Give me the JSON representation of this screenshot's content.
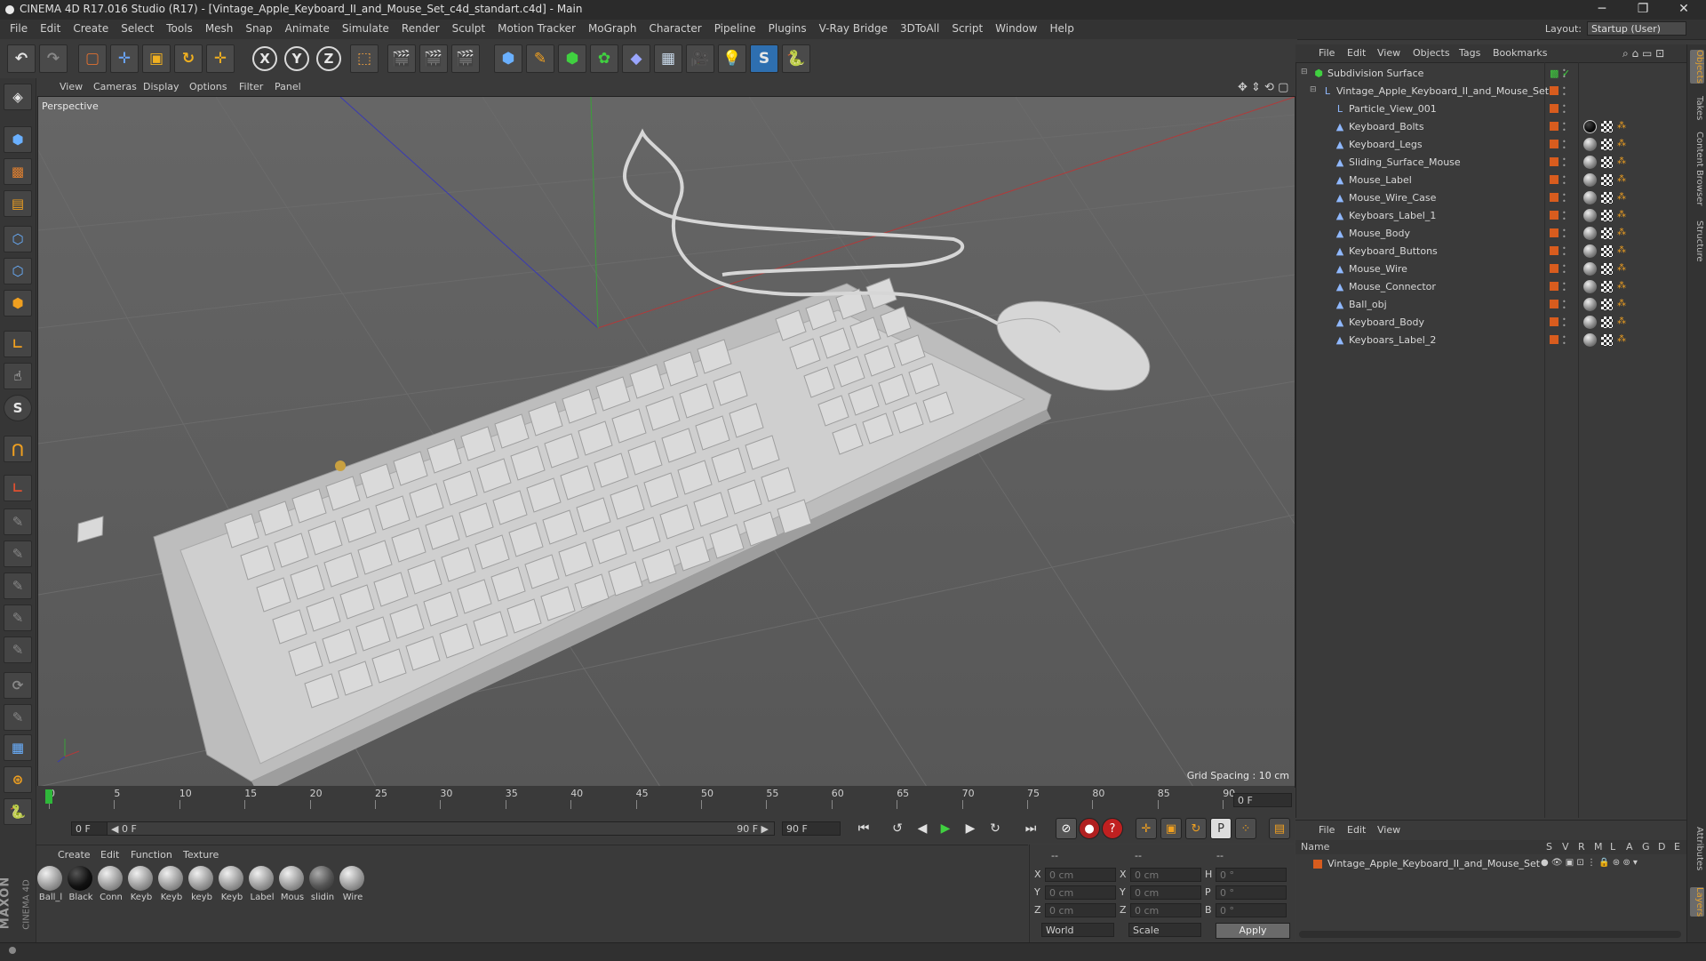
{
  "window": {
    "title": "CINEMA 4D R17.016 Studio (R17) - [Vintage_Apple_Keyboard_II_and_Mouse_Set_c4d_standart.c4d] - Main",
    "min": "─",
    "max": "❐",
    "close": "✕"
  },
  "menubar": {
    "items": [
      "File",
      "Edit",
      "Create",
      "Select",
      "Tools",
      "Mesh",
      "Snap",
      "Animate",
      "Simulate",
      "Render",
      "Sculpt",
      "Motion Tracker",
      "MoGraph",
      "Character",
      "Pipeline",
      "Plugins",
      "V-Ray Bridge",
      "3DToAll",
      "Script",
      "Window",
      "Help"
    ],
    "layout_label": "Layout:",
    "layout_value": "Startup (User)"
  },
  "toolbar": {
    "undo": "↶",
    "redo": "↷",
    "x": "X",
    "y": "Y",
    "z": "Z"
  },
  "viewport": {
    "menu": [
      "View",
      "Cameras",
      "Display",
      "Options",
      "Filter",
      "Panel"
    ],
    "label": "Perspective",
    "grid_spacing": "Grid Spacing : 10 cm"
  },
  "timeline": {
    "ticks": [
      "0",
      "5",
      "10",
      "15",
      "20",
      "25",
      "30",
      "35",
      "40",
      "45",
      "50",
      "55",
      "60",
      "65",
      "70",
      "75",
      "80",
      "85",
      "90"
    ],
    "current_frame": "0 F",
    "start_field": "0 F",
    "range_start": "◀ 0 F",
    "range_end": "90 F ▶",
    "end_field": "90 F"
  },
  "materials": {
    "menu": [
      "Create",
      "Edit",
      "Function",
      "Texture"
    ],
    "items": [
      {
        "label": "Ball_l",
        "style": "light"
      },
      {
        "label": "Black",
        "style": "black"
      },
      {
        "label": "Conn",
        "style": "light"
      },
      {
        "label": "Keyb",
        "style": "light"
      },
      {
        "label": "Keyb",
        "style": "light"
      },
      {
        "label": "keyb",
        "style": "light"
      },
      {
        "label": "Keyb",
        "style": "light"
      },
      {
        "label": "Label",
        "style": "light"
      },
      {
        "label": "Mous",
        "style": "light"
      },
      {
        "label": "slidin",
        "style": "dark"
      },
      {
        "label": "Wire",
        "style": "light"
      }
    ]
  },
  "coords": {
    "header": [
      "--",
      "--",
      "--"
    ],
    "rows": [
      {
        "a": "X",
        "av": "0 cm",
        "b": "X",
        "bv": "0 cm",
        "c": "H",
        "cv": "0 °"
      },
      {
        "a": "Y",
        "av": "0 cm",
        "b": "Y",
        "bv": "0 cm",
        "c": "P",
        "cv": "0 °"
      },
      {
        "a": "Z",
        "av": "0 cm",
        "b": "Z",
        "bv": "0 cm",
        "c": "B",
        "cv": "0 °"
      }
    ],
    "mode1": "World",
    "mode2": "Scale",
    "apply": "Apply"
  },
  "objects": {
    "menu": [
      "File",
      "Edit",
      "View",
      "Objects",
      "Tags",
      "Bookmarks"
    ],
    "items": [
      {
        "name": "Subdivision Surface",
        "icon": "subdivision-icon"
      },
      {
        "name": "Vintage_Apple_Keyboard_II_and_Mouse_Set",
        "icon": "null-icon"
      },
      {
        "name": "Particle_View_001",
        "icon": "null-icon"
      },
      {
        "name": "Keyboard_Bolts",
        "icon": "polygon-icon"
      },
      {
        "name": "Keyboard_Legs",
        "icon": "polygon-icon"
      },
      {
        "name": "Sliding_Surface_Mouse",
        "icon": "polygon-icon"
      },
      {
        "name": "Mouse_Label",
        "icon": "polygon-icon"
      },
      {
        "name": "Mouse_Wire_Case",
        "icon": "polygon-icon"
      },
      {
        "name": "Keyboars_Label_1",
        "icon": "polygon-icon"
      },
      {
        "name": "Mouse_Body",
        "icon": "polygon-icon"
      },
      {
        "name": "Keyboard_Buttons",
        "icon": "polygon-icon"
      },
      {
        "name": "Mouse_Wire",
        "icon": "polygon-icon"
      },
      {
        "name": "Mouse_Connector",
        "icon": "polygon-icon"
      },
      {
        "name": "Ball_obj",
        "icon": "polygon-icon"
      },
      {
        "name": "Keyboard_Body",
        "icon": "polygon-icon"
      },
      {
        "name": "Keyboars_Label_2",
        "icon": "polygon-icon"
      }
    ]
  },
  "layers": {
    "menu": [
      "File",
      "Edit",
      "View"
    ],
    "columns": [
      "Name",
      "S",
      "V",
      "R",
      "M",
      "L",
      "A",
      "G",
      "D",
      "E"
    ],
    "row": "Vintage_Apple_Keyboard_II_and_Mouse_Set"
  },
  "right_tabs": [
    "Objects",
    "Takes",
    "Content Browser",
    "Structure",
    "Attributes",
    "Layers"
  ],
  "brand": {
    "maxon": "MAXON",
    "c4d": "CINEMA 4D"
  },
  "colors": {
    "accent_orange": "#d85c1e",
    "grid_red": "#b23a3a",
    "grid_green": "#3aa03a",
    "grid_blue": "#3a3ab2"
  }
}
